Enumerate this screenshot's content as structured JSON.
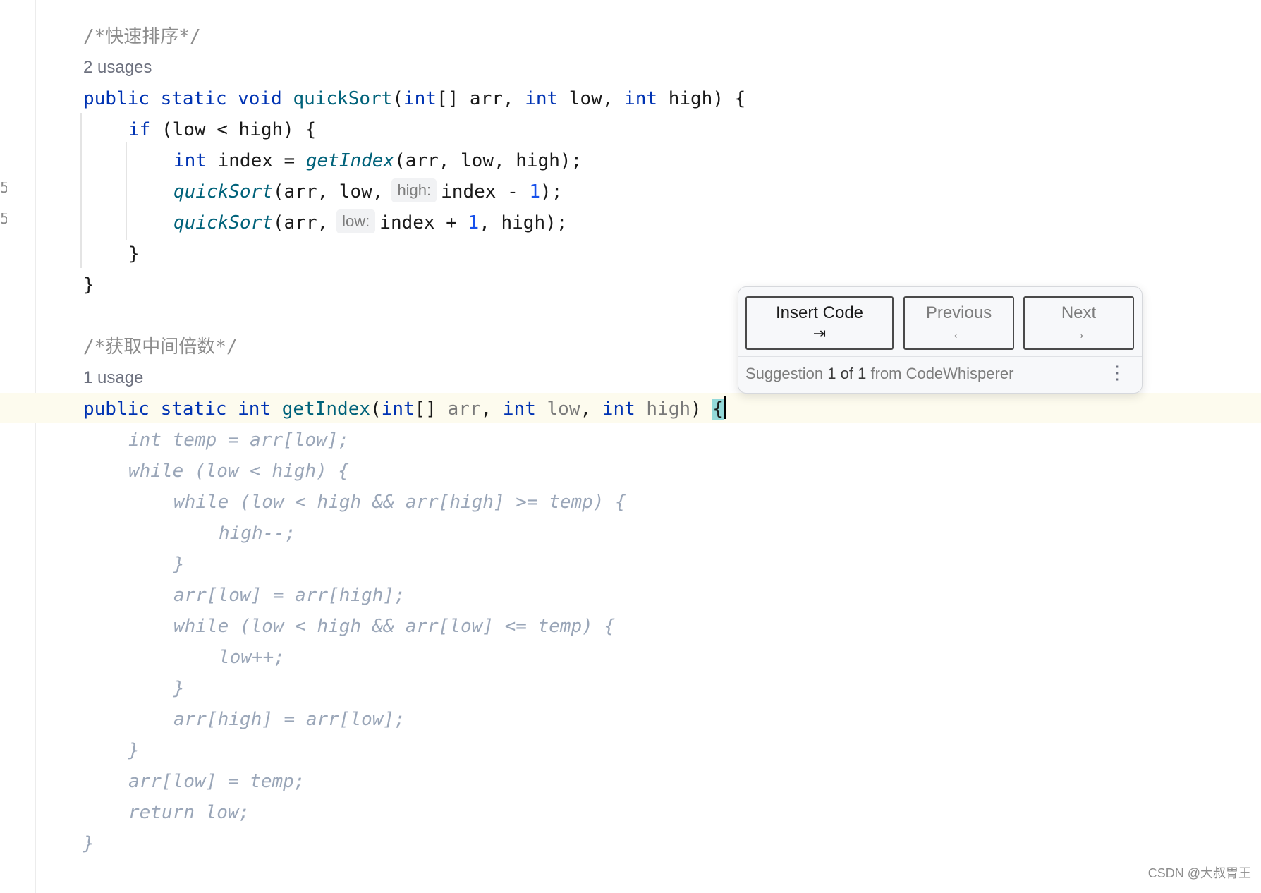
{
  "gutter": {
    "marks": [
      "5",
      "5"
    ]
  },
  "comments": {
    "quicksort": "/*快速排序*/",
    "getindex": "/*获取中间倍数*/"
  },
  "usages": {
    "quicksort": "2 usages",
    "getindex": "1 usage"
  },
  "code": {
    "kw_public": "public",
    "kw_static": "static",
    "kw_void": "void",
    "kw_int": "int",
    "kw_if": "if",
    "fn_quicksort": "quickSort",
    "fn_getindex": "getIndex",
    "num_one": "1",
    "hint_high": "high:",
    "hint_low": "low:"
  },
  "suggestion_lines": [
    "int temp = arr[low];",
    "while (low < high) {",
    "while (low < high && arr[high] >= temp) {",
    "high--;",
    "}",
    "arr[low] = arr[high];",
    "while (low < high && arr[low] <= temp) {",
    "low++;",
    "}",
    "arr[high] = arr[low];",
    "}",
    "arr[low] = temp;",
    "return low;",
    "}"
  ],
  "popup": {
    "insert_label": "Insert Code",
    "insert_key": "⇥",
    "previous_label": "Previous",
    "previous_key": "←",
    "next_label": "Next",
    "next_key": "→",
    "status_prefix": "Suggestion",
    "status_index": "1",
    "status_of": "of",
    "status_total": "1",
    "status_source": "from CodeWhisperer",
    "more_icon": "⋮"
  },
  "watermark": "CSDN @大叔胃王"
}
